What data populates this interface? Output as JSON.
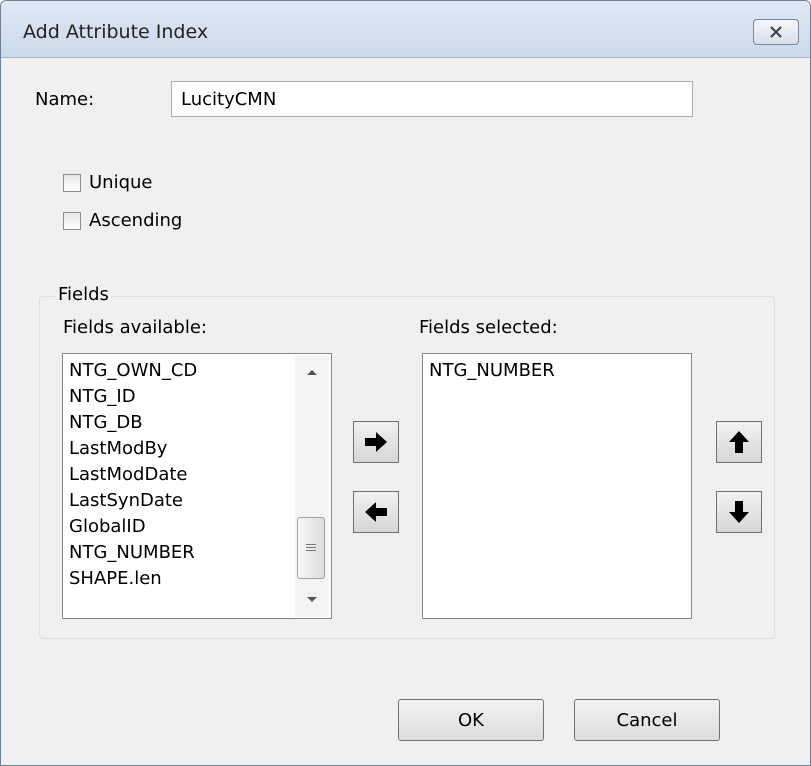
{
  "window": {
    "title": "Add Attribute Index"
  },
  "name": {
    "label": "Name:",
    "value": "LucityCMN"
  },
  "options": {
    "unique": "Unique",
    "ascending": "Ascending"
  },
  "fields": {
    "group_title": "Fields",
    "available_label": "Fields available:",
    "selected_label": "Fields selected:",
    "available": [
      "NTG_OWN_CD",
      "NTG_ID",
      "NTG_DB",
      "LastModBy",
      "LastModDate",
      "LastSynDate",
      "GlobalID",
      "NTG_NUMBER",
      "SHAPE.len"
    ],
    "selected": [
      "NTG_NUMBER"
    ]
  },
  "buttons": {
    "ok": "OK",
    "cancel": "Cancel"
  },
  "icons": {
    "close": "close-icon",
    "add": "arrow-right-icon",
    "remove": "arrow-left-icon",
    "move_up": "arrow-up-icon",
    "move_down": "arrow-down-icon"
  }
}
